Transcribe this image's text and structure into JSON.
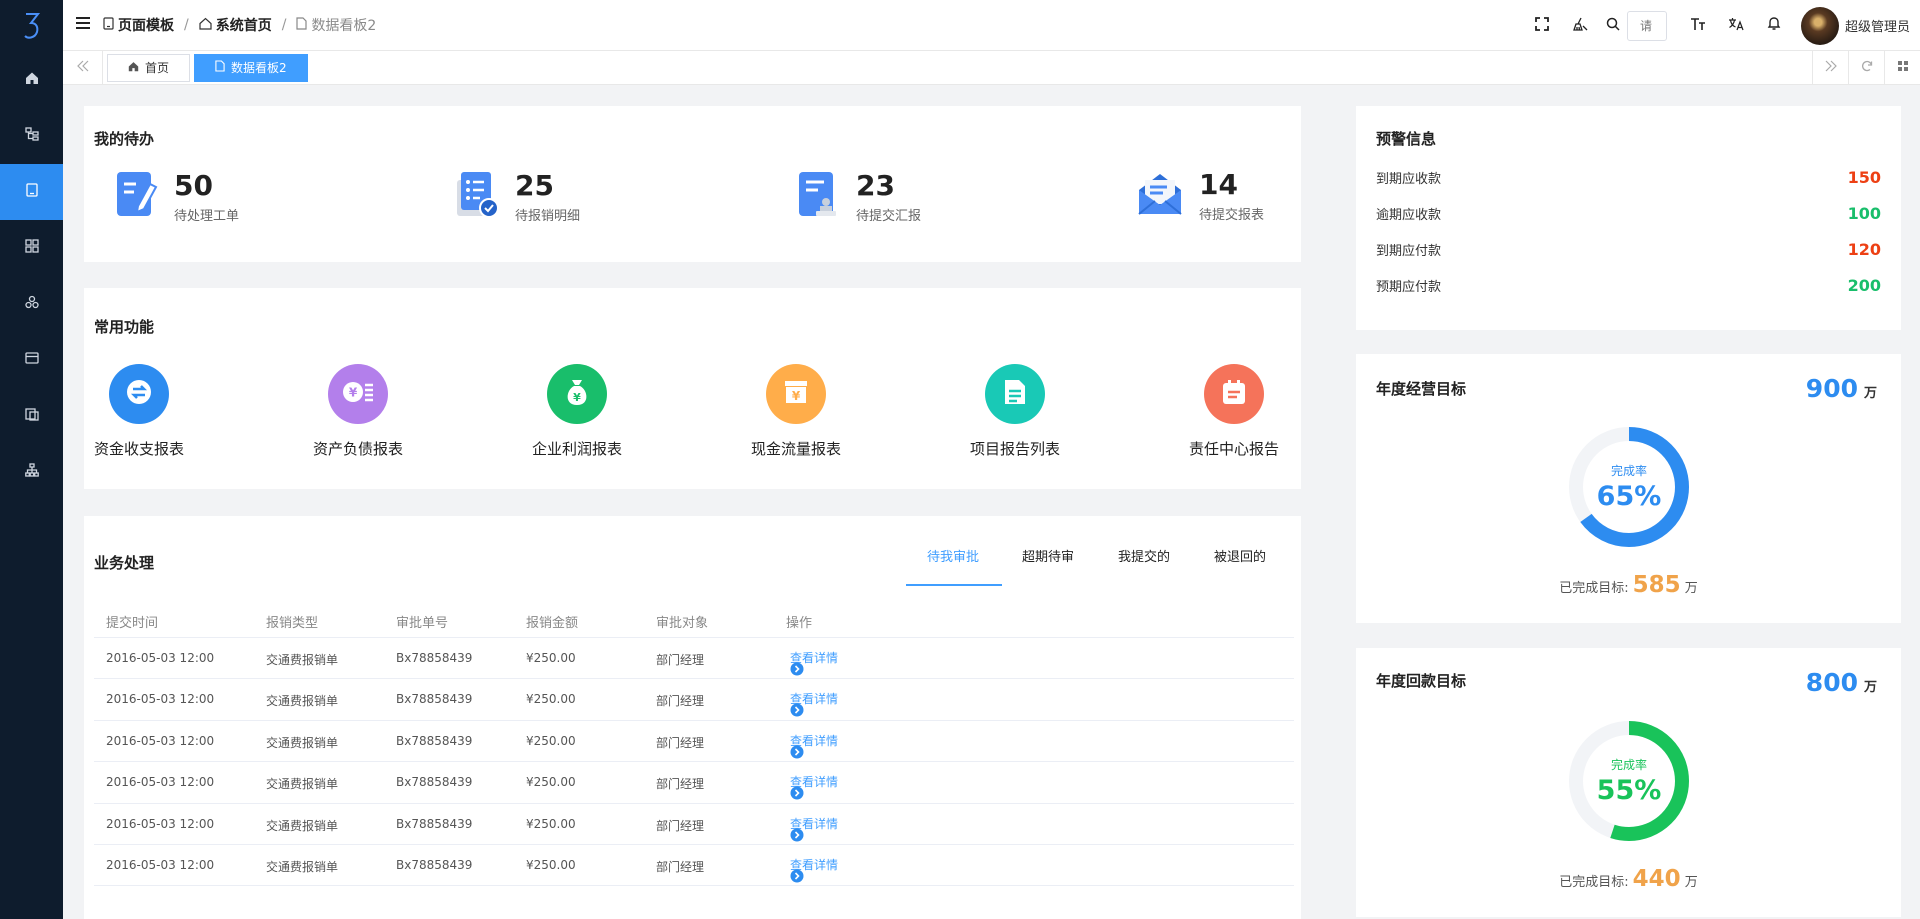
{
  "breadcrumb": {
    "items": [
      "页面模板",
      "系统首页",
      "数据看板2"
    ]
  },
  "header": {
    "search_placeholder": "请",
    "username": "超级管理员"
  },
  "tabs": [
    {
      "label": "首页"
    },
    {
      "label": "数据看板2"
    }
  ],
  "todo": {
    "title": "我的待办",
    "items": [
      {
        "count": "50",
        "label": "待处理工单"
      },
      {
        "count": "25",
        "label": "待报销明细"
      },
      {
        "count": "23",
        "label": "待提交汇报"
      },
      {
        "count": "14",
        "label": "待提交报表"
      }
    ]
  },
  "functions": {
    "title": "常用功能",
    "items": [
      {
        "label": "资金收支报表",
        "color": "#2d8cf0"
      },
      {
        "label": "资产负债报表",
        "color": "#b37feb"
      },
      {
        "label": "企业利润报表",
        "color": "#19be6b"
      },
      {
        "label": "现金流量报表",
        "color": "#ffad4a"
      },
      {
        "label": "项目报告列表",
        "color": "#19c9b6"
      },
      {
        "label": "责任中心报告",
        "color": "#f5735a"
      }
    ]
  },
  "business": {
    "title": "业务处理",
    "tabs": [
      "待我审批",
      "超期待审",
      "我提交的",
      "被退回的"
    ],
    "columns": [
      "提交时间",
      "报销类型",
      "审批单号",
      "报销金额",
      "审批对象",
      "操作"
    ],
    "rows": [
      {
        "time": "2016-05-03 12:00",
        "type": "交通费报销单",
        "no": "Bx78858439",
        "amount": "¥250.00",
        "target": "部门经理",
        "action": "查看详情"
      },
      {
        "time": "2016-05-03 12:00",
        "type": "交通费报销单",
        "no": "Bx78858439",
        "amount": "¥250.00",
        "target": "部门经理",
        "action": "查看详情"
      },
      {
        "time": "2016-05-03 12:00",
        "type": "交通费报销单",
        "no": "Bx78858439",
        "amount": "¥250.00",
        "target": "部门经理",
        "action": "查看详情"
      },
      {
        "time": "2016-05-03 12:00",
        "type": "交通费报销单",
        "no": "Bx78858439",
        "amount": "¥250.00",
        "target": "部门经理",
        "action": "查看详情"
      },
      {
        "time": "2016-05-03 12:00",
        "type": "交通费报销单",
        "no": "Bx78858439",
        "amount": "¥250.00",
        "target": "部门经理",
        "action": "查看详情"
      },
      {
        "time": "2016-05-03 12:00",
        "type": "交通费报销单",
        "no": "Bx78858439",
        "amount": "¥250.00",
        "target": "部门经理",
        "action": "查看详情"
      }
    ]
  },
  "warning": {
    "title": "预警信息",
    "items": [
      {
        "label": "到期应收款",
        "value": "150",
        "color": "#ed4014"
      },
      {
        "label": "逾期应收款",
        "value": "100",
        "color": "#19be6b"
      },
      {
        "label": "到期应付款",
        "value": "120",
        "color": "#ed4014"
      },
      {
        "label": "预期应付款",
        "value": "200",
        "color": "#19be6b"
      }
    ]
  },
  "annual_goal": {
    "title": "年度经营目标",
    "target": "900",
    "unit": "万",
    "ring_label": "完成率",
    "percent": 65,
    "percent_text": "65%",
    "done_label": "已完成目标:",
    "done_value": "585",
    "done_unit": "万",
    "color": "#2d8cf0"
  },
  "payback_goal": {
    "title": "年度回款目标",
    "target": "800",
    "unit": "万",
    "ring_label": "完成率",
    "percent": 55,
    "percent_text": "55%",
    "done_label": "已完成目标:",
    "done_value": "440",
    "done_unit": "万",
    "color": "#19c35a"
  }
}
